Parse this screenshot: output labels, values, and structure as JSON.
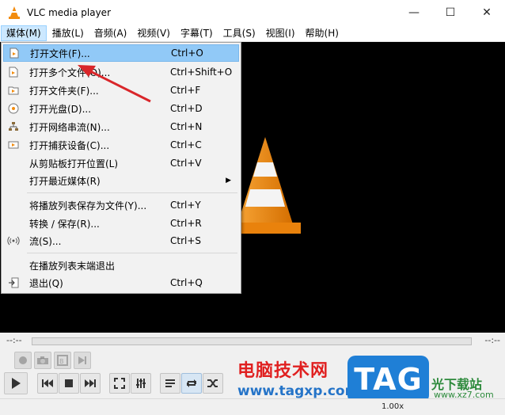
{
  "window": {
    "title": "VLC media player",
    "minimize": "—",
    "maximize": "☐",
    "close": "✕"
  },
  "menubar": [
    {
      "label": "媒体(M)"
    },
    {
      "label": "播放(L)"
    },
    {
      "label": "音频(A)"
    },
    {
      "label": "视频(V)"
    },
    {
      "label": "字幕(T)"
    },
    {
      "label": "工具(S)"
    },
    {
      "label": "视图(I)"
    },
    {
      "label": "帮助(H)"
    }
  ],
  "media_menu": {
    "items": [
      {
        "label": "打开文件(F)...",
        "shortcut": "Ctrl+O",
        "icon": "file-icon"
      },
      {
        "label": "打开多个文件(O)...",
        "shortcut": "Ctrl+Shift+O",
        "icon": "files-icon"
      },
      {
        "label": "打开文件夹(F)...",
        "shortcut": "Ctrl+F",
        "icon": "folder-icon"
      },
      {
        "label": "打开光盘(D)...",
        "shortcut": "Ctrl+D",
        "icon": "disc-icon"
      },
      {
        "label": "打开网络串流(N)...",
        "shortcut": "Ctrl+N",
        "icon": "network-icon"
      },
      {
        "label": "打开捕获设备(C)...",
        "shortcut": "Ctrl+C",
        "icon": "capture-icon"
      },
      {
        "label": "从剪贴板打开位置(L)",
        "shortcut": "Ctrl+V",
        "icon": ""
      },
      {
        "label": "打开最近媒体(R)",
        "shortcut": "",
        "icon": "",
        "submenu": "▶"
      },
      {
        "label": "将播放列表保存为文件(Y)...",
        "shortcut": "Ctrl+Y",
        "icon": ""
      },
      {
        "label": "转换 / 保存(R)...",
        "shortcut": "Ctrl+R",
        "icon": ""
      },
      {
        "label": "流(S)...",
        "shortcut": "Ctrl+S",
        "icon": "stream-icon"
      },
      {
        "label": "在播放列表末端退出",
        "shortcut": "",
        "icon": ""
      },
      {
        "label": "退出(Q)",
        "shortcut": "Ctrl+Q",
        "icon": "exit-icon"
      }
    ]
  },
  "seek": {
    "elapsed": "--:--",
    "remaining": "--:--"
  },
  "status": {
    "speed": "1.00x"
  },
  "watermark": {
    "title": "电脑技术网",
    "url": "www.tagxp.com",
    "logo": "TAG",
    "site": "光下载站",
    "site_url": "www.xz7.com"
  },
  "colors": {
    "menu_highlight": "#91c9f7",
    "active_menu": "#cce8ff",
    "annotation_arrow": "#d9262a",
    "vlc_orange": "#f28c0f"
  }
}
